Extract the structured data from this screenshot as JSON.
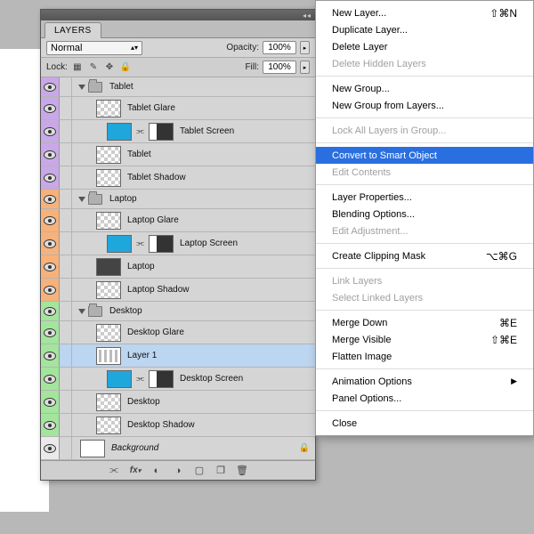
{
  "panel": {
    "tab_label": "LAYERS",
    "blend_mode": "Normal",
    "opacity_label": "Opacity:",
    "opacity_value": "100%",
    "lock_label": "Lock:",
    "fill_label": "Fill:",
    "fill_value": "100%"
  },
  "groups": [
    {
      "color": "purple",
      "name": "Tablet",
      "layers": [
        {
          "name": "Tablet Glare",
          "thumb": "trans",
          "mask": false
        },
        {
          "name": "Tablet Screen",
          "thumb": "blue",
          "mask": true
        },
        {
          "name": "Tablet",
          "thumb": "trans",
          "mask": false
        },
        {
          "name": "Tablet Shadow",
          "thumb": "trans",
          "mask": false
        }
      ]
    },
    {
      "color": "orange",
      "name": "Laptop",
      "layers": [
        {
          "name": "Laptop Glare",
          "thumb": "trans",
          "mask": false
        },
        {
          "name": "Laptop Screen",
          "thumb": "blue",
          "mask": true
        },
        {
          "name": "Laptop",
          "thumb": "trans",
          "mask": false,
          "dark": true
        },
        {
          "name": "Laptop Shadow",
          "thumb": "trans",
          "mask": false
        }
      ]
    },
    {
      "color": "green",
      "name": "Desktop",
      "layers": [
        {
          "name": "Desktop Glare",
          "thumb": "trans",
          "mask": false
        },
        {
          "name": "Layer 1",
          "thumb": "img",
          "mask": false,
          "selected": true
        },
        {
          "name": "Desktop Screen",
          "thumb": "blue",
          "mask": true
        },
        {
          "name": "Desktop",
          "thumb": "trans",
          "mask": false
        },
        {
          "name": "Desktop Shadow",
          "thumb": "trans",
          "mask": false
        }
      ]
    }
  ],
  "background_layer": "Background",
  "menu": {
    "sections": [
      [
        {
          "label": "New Layer...",
          "shortcut": "⇧⌘N"
        },
        {
          "label": "Duplicate Layer..."
        },
        {
          "label": "Delete Layer"
        },
        {
          "label": "Delete Hidden Layers",
          "disabled": true
        }
      ],
      [
        {
          "label": "New Group..."
        },
        {
          "label": "New Group from Layers..."
        }
      ],
      [
        {
          "label": "Lock All Layers in Group...",
          "disabled": true
        }
      ],
      [
        {
          "label": "Convert to Smart Object",
          "selected": true
        },
        {
          "label": "Edit Contents",
          "disabled": true
        }
      ],
      [
        {
          "label": "Layer Properties..."
        },
        {
          "label": "Blending Options..."
        },
        {
          "label": "Edit Adjustment...",
          "disabled": true
        }
      ],
      [
        {
          "label": "Create Clipping Mask",
          "shortcut": "⌥⌘G"
        }
      ],
      [
        {
          "label": "Link Layers",
          "disabled": true
        },
        {
          "label": "Select Linked Layers",
          "disabled": true
        }
      ],
      [
        {
          "label": "Merge Down",
          "shortcut": "⌘E"
        },
        {
          "label": "Merge Visible",
          "shortcut": "⇧⌘E"
        },
        {
          "label": "Flatten Image"
        }
      ],
      [
        {
          "label": "Animation Options",
          "submenu": true
        },
        {
          "label": "Panel Options..."
        }
      ],
      [
        {
          "label": "Close"
        }
      ]
    ]
  }
}
